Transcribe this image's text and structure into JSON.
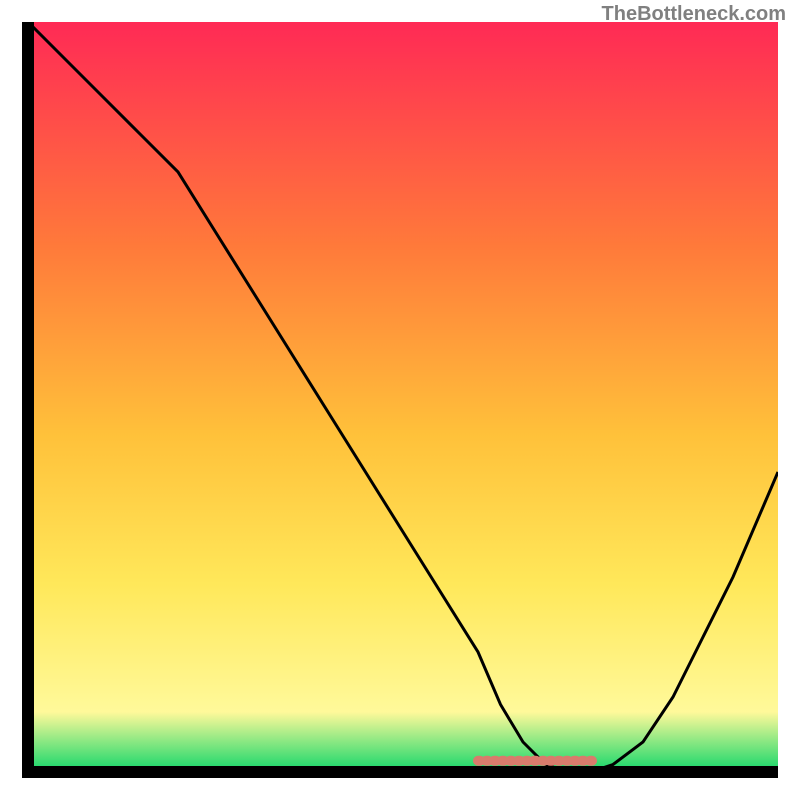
{
  "watermark": "TheBottleneck.com",
  "chart_data": {
    "type": "line",
    "title": "",
    "xlabel": "",
    "ylabel": "",
    "xlim": [
      0,
      100
    ],
    "ylim": [
      0,
      100
    ],
    "series": [
      {
        "name": "curve",
        "x": [
          0,
          5,
          10,
          15,
          20,
          25,
          30,
          35,
          40,
          45,
          50,
          55,
          60,
          63,
          66,
          69,
          72,
          75,
          78,
          82,
          86,
          90,
          94,
          100
        ],
        "values": [
          100,
          95,
          90,
          85,
          80,
          72,
          64,
          56,
          48,
          40,
          32,
          24,
          16,
          9,
          4,
          1,
          0,
          0,
          1,
          4,
          10,
          18,
          26,
          40
        ]
      },
      {
        "name": "marker-band",
        "x": [
          60,
          76
        ],
        "values": [
          1.5,
          1.5
        ]
      }
    ],
    "gradient_colors": {
      "top": "#ff2a55",
      "mid1": "#ff7a3a",
      "mid2": "#ffc13a",
      "mid3": "#ffe85a",
      "mid4": "#fff99a",
      "bottom": "#12d66a"
    },
    "curve_color": "#000000",
    "marker_color": "#d97b6c",
    "axis_color": "#000000"
  }
}
